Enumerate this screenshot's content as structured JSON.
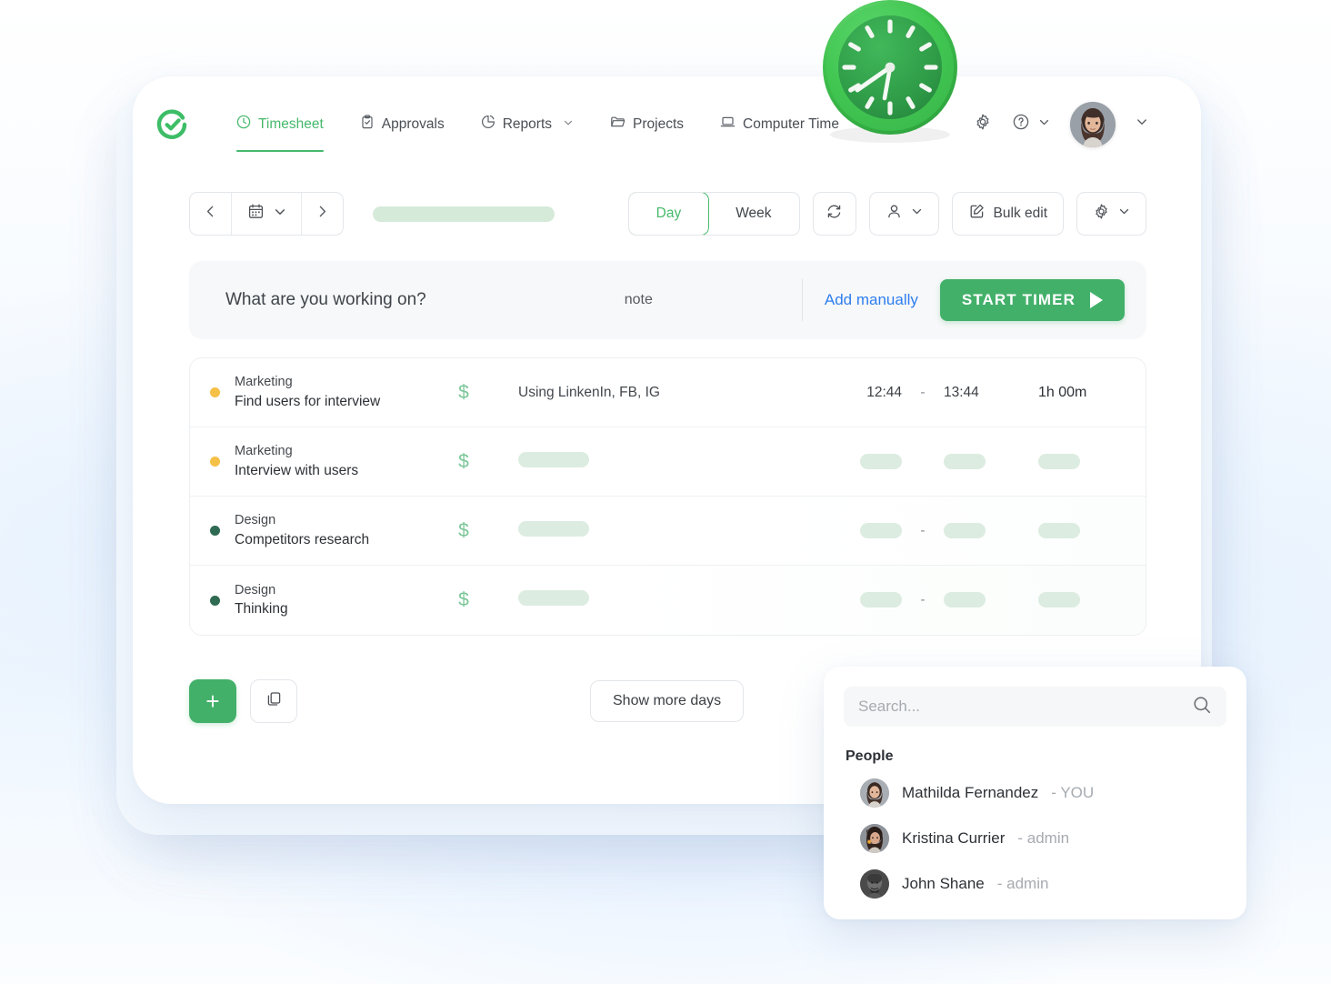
{
  "brand": {
    "logo_icon": "check-circle-logo",
    "accent_green": "#43b06a",
    "link_blue": "#2f7ef0"
  },
  "nav": {
    "items": [
      {
        "label": "Timesheet",
        "icon": "clock-icon",
        "active": true,
        "has_chevron": false
      },
      {
        "label": "Approvals",
        "icon": "clipboard-check-icon",
        "active": false,
        "has_chevron": false
      },
      {
        "label": "Reports",
        "icon": "pie-chart-icon",
        "active": false,
        "has_chevron": true
      },
      {
        "label": "Projects",
        "icon": "folder-icon",
        "active": false,
        "has_chevron": false
      },
      {
        "label": "Computer Time",
        "icon": "laptop-icon",
        "active": false,
        "has_chevron": true
      }
    ],
    "settings_icon": "gear-icon",
    "help_icon": "question-circle-icon",
    "avatar_icon": "user-avatar",
    "profile_chevron": "chevron-down-icon"
  },
  "toolbar": {
    "prev_icon": "chevron-left-icon",
    "calendar_icon": "calendar-icon",
    "calendar_chevron": "chevron-down-icon",
    "next_icon": "chevron-right-icon",
    "date_value": "",
    "view_day": "Day",
    "view_week": "Week",
    "view_selected": "Day",
    "refresh_icon": "refresh-icon",
    "person_icon": "person-icon",
    "bulk_edit_label": "Bulk edit",
    "bulk_edit_icon": "edit-square-icon",
    "settings_icon": "gear-icon"
  },
  "timer": {
    "task_placeholder": "What are you working on?",
    "note_placeholder": "note",
    "add_manually_label": "Add manually",
    "start_timer_label": "START TIMER",
    "play_icon": "play-icon"
  },
  "entries": [
    {
      "project": "Marketing",
      "task": "Find users for interview",
      "dot_color": "#f5c046",
      "billable_icon": "dollar-icon",
      "note": "Using LinkenIn, FB, IG",
      "start": "12:44",
      "dash": "-",
      "end": "13:44",
      "duration": "1h 00m",
      "loading": false
    },
    {
      "project": "Marketing",
      "task": "Interview with users",
      "dot_color": "#f5c046",
      "billable_icon": "dollar-icon",
      "note": "",
      "start": "",
      "dash": "",
      "end": "",
      "duration": "",
      "loading": true
    },
    {
      "project": "Design",
      "task": "Competitors research",
      "dot_color": "#2f6b52",
      "billable_icon": "dollar-icon",
      "note": "",
      "start": "",
      "dash": "-",
      "end": "",
      "duration": "",
      "loading": true
    },
    {
      "project": "Design",
      "task": "Thinking",
      "dot_color": "#2f6b52",
      "billable_icon": "dollar-icon",
      "note": "",
      "start": "",
      "dash": "-",
      "end": "",
      "duration": "",
      "loading": true
    }
  ],
  "bottom": {
    "add_label": "+",
    "copy_icon": "copy-icon",
    "show_more_label": "Show more days"
  },
  "search_panel": {
    "search_placeholder": "Search...",
    "search_value": "",
    "search_icon": "search-icon",
    "section_title": "People",
    "people": [
      {
        "name": "Mathilda Fernandez",
        "separator": " - ",
        "role": "YOU",
        "avatar": "avatar-mathilda"
      },
      {
        "name": "Kristina Currier",
        "separator": "- ",
        "role": "admin",
        "avatar": "avatar-kristina"
      },
      {
        "name": "John Shane",
        "separator": " - ",
        "role": "admin",
        "avatar": "avatar-john"
      }
    ]
  },
  "decoration": {
    "clock_icon": "green-wall-clock"
  }
}
